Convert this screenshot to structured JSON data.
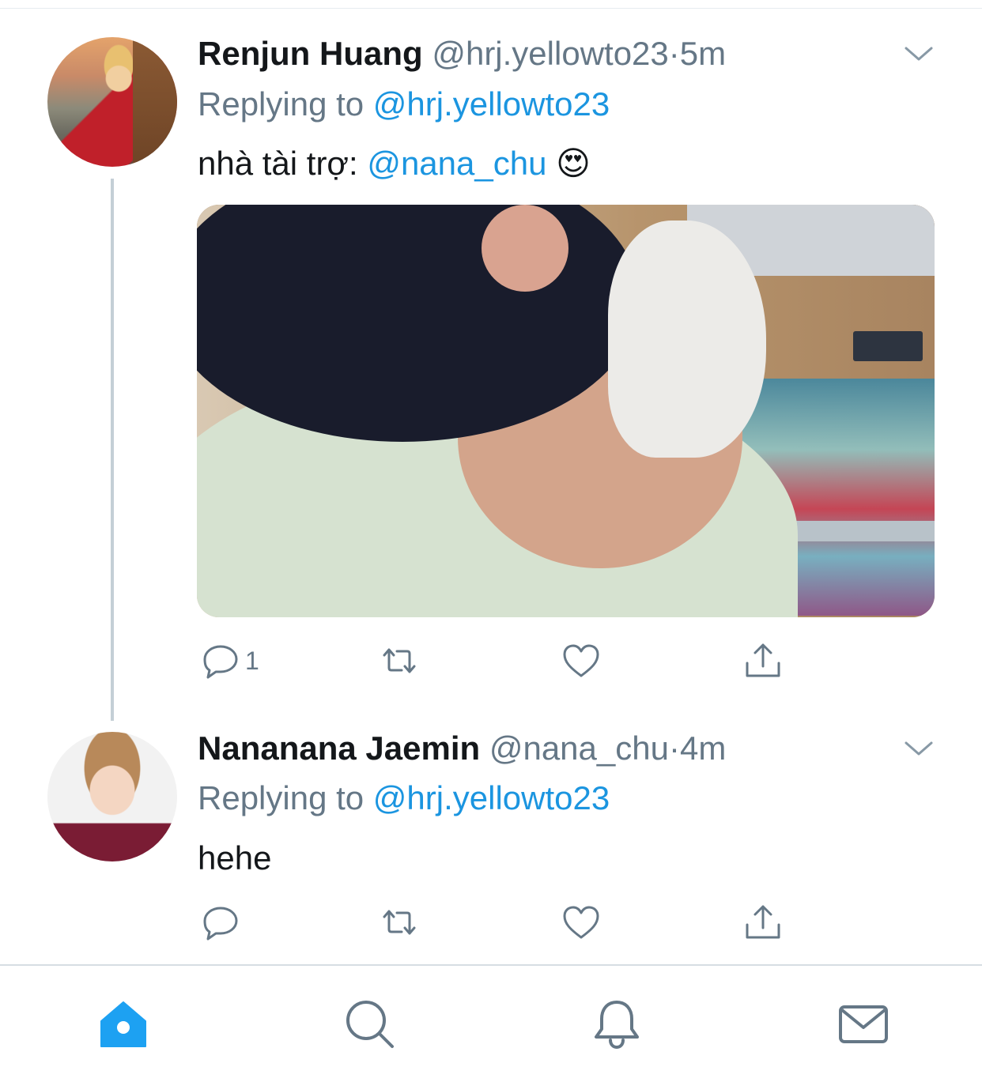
{
  "tweets": [
    {
      "display_name": "Renjun Huang",
      "handle": "@hrj.yellowto23",
      "separator": "·",
      "time": "5m",
      "replying_prefix": "Replying to",
      "replying_to": "@hrj.yellowto23",
      "text_prefix": "nhà tài trợ:",
      "mention": "@nana_chu",
      "emoji": "😍",
      "reply_count": "1",
      "has_media": true
    },
    {
      "display_name": "Nananana Jaemin",
      "handle": "@nana_chu",
      "separator": "·",
      "time": "4m",
      "replying_prefix": "Replying to",
      "replying_to": "@hrj.yellowto23",
      "text": "hehe",
      "reply_count": ""
    }
  ],
  "icons": {
    "reply": "reply-icon",
    "retweet": "retweet-icon",
    "like": "heart-icon",
    "share": "share-icon",
    "menu": "chevron-down-icon"
  },
  "tabbar": [
    {
      "name": "home",
      "icon": "home-icon",
      "active": true
    },
    {
      "name": "search",
      "icon": "search-icon",
      "active": false
    },
    {
      "name": "notifications",
      "icon": "bell-icon",
      "active": false
    },
    {
      "name": "messages",
      "icon": "mail-icon",
      "active": false
    }
  ],
  "colors": {
    "accent": "#1da1f2",
    "link": "#1b95e0",
    "muted": "#657786",
    "text": "#14171a",
    "icon": "#657786"
  }
}
